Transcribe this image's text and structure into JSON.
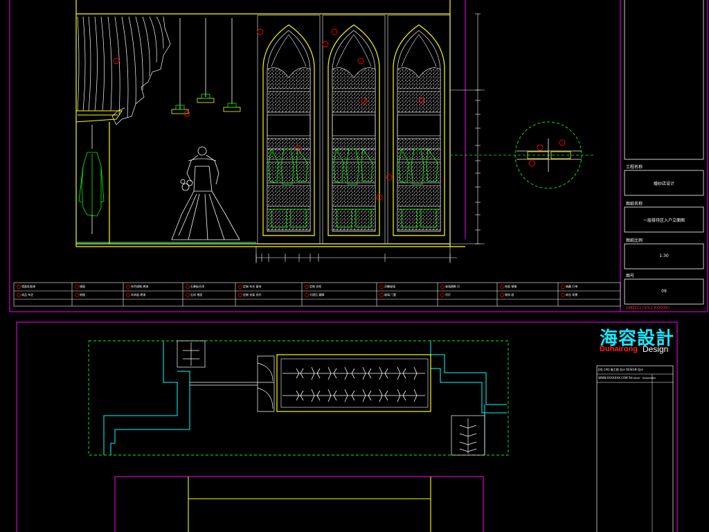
{
  "logo": {
    "cn": "海容設計",
    "en_brand": "Duhairong",
    "en_suffix": "Design"
  },
  "title_block": {
    "items": [
      {
        "label": "工程名称",
        "value": "婚纱店设计"
      },
      {
        "label": "图纸名称",
        "value": "一层接待区入户立面图"
      },
      {
        "label": "图纸比例",
        "value": "1:30"
      },
      {
        "label": "图号",
        "value": "09"
      }
    ],
    "footer": "1980211 (3/3/2 AXXXXX)"
  },
  "logo_contact": [
    "JUIJ  CAD 施工图 设计 DESIGN 设计",
    "WWW.XXXXXXX.COM  Tel:xxxx - xxxxxxxx"
  ],
  "legend": [
    [
      "墙面乳胶漆",
      "镜面",
      "灰色镜钢 烤漆",
      "石膏板吊顶",
      "定制 布艺 窗帘",
      "定制 衣柜",
      "浮雕玻璃",
      "玻璃隔断 灯",
      "饰面 镜钢",
      "暗藏 灯带"
    ],
    [
      "成品 布艺",
      "地毯",
      "木饰面 烤漆",
      "石材 地面",
      "定制 衣架 衣杆",
      "大理石 踢脚",
      "玻璃 门套",
      "吊灯",
      "装饰 画",
      "软包 背景"
    ]
  ],
  "colors": {
    "background": "#000000",
    "frame": "#ff00ff",
    "outline": "#ffff00",
    "hatch": "#ffffff",
    "figure": "#00ff00",
    "marker": "#ff0000",
    "dashed": "#00ff00",
    "wall": "#00ffff"
  }
}
